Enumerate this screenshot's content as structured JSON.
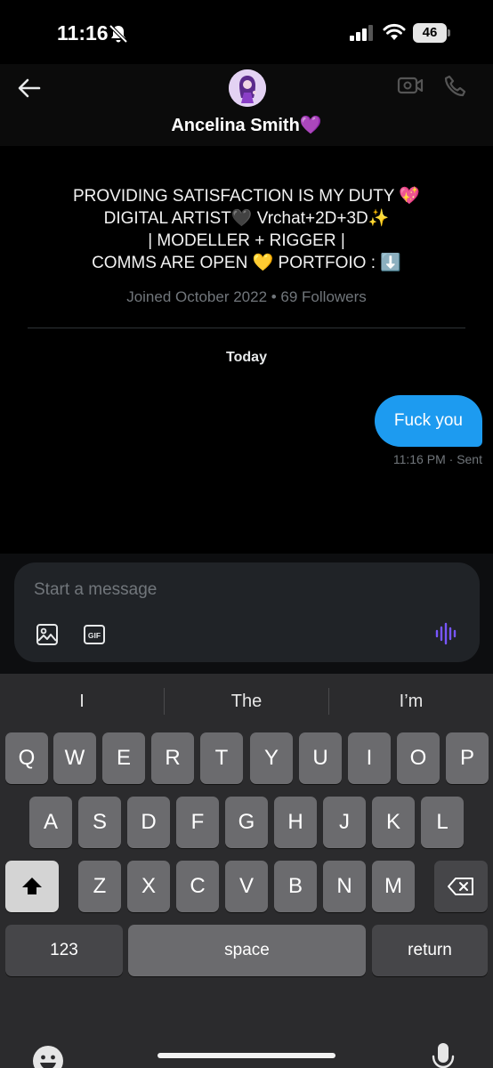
{
  "status_bar": {
    "time": "11:16",
    "battery": "46"
  },
  "header": {
    "contact_name": "Ancelina Smith💜"
  },
  "profile": {
    "bio_lines": [
      "PROVIDING SATISFACTION IS MY DUTY 💖",
      "DIGITAL ARTIST🖤 Vrchat+2D+3D✨",
      "| MODELLER + RIGGER |",
      "COMMS ARE OPEN 💛 PORTFOIO : ⬇️"
    ],
    "joined": "Joined October 2022 • 69 Followers"
  },
  "conversation": {
    "date_separator": "Today",
    "messages": [
      {
        "text": "Fuck you",
        "time": "11:16 PM",
        "status": "Sent"
      }
    ]
  },
  "composer": {
    "placeholder": "Start a message",
    "icons": [
      "image-icon",
      "gif-icon",
      "voice-icon"
    ],
    "gif_label": "GIF"
  },
  "keyboard": {
    "suggestions": [
      "I",
      "The",
      "I’m"
    ],
    "row1": [
      "Q",
      "W",
      "E",
      "R",
      "T",
      "Y",
      "U",
      "I",
      "O",
      "P"
    ],
    "row2": [
      "A",
      "S",
      "D",
      "F",
      "G",
      "H",
      "J",
      "K",
      "L"
    ],
    "row3": [
      "Z",
      "X",
      "C",
      "V",
      "B",
      "N",
      "M"
    ],
    "numbers_label": "123",
    "space_label": "space",
    "return_label": "return"
  },
  "colors": {
    "accent": "#1d9bf0",
    "voice": "#7856ff"
  }
}
